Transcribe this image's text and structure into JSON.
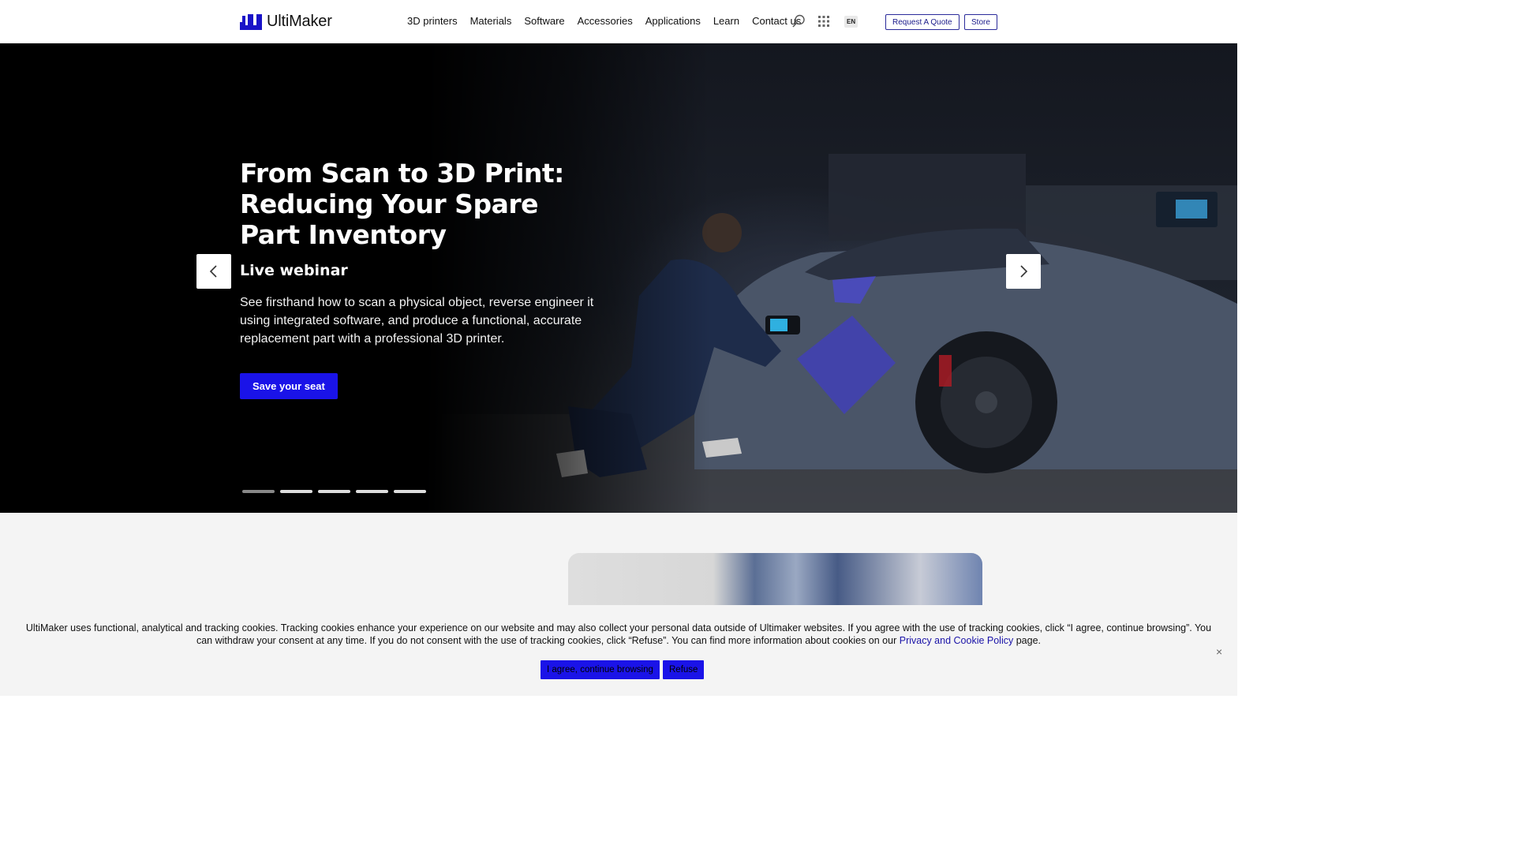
{
  "brand": {
    "name": "UltiMaker",
    "accent": "#1a13e8"
  },
  "nav": {
    "items": [
      "3D printers",
      "Materials",
      "Software",
      "Accessories",
      "Applications",
      "Learn",
      "Contact us"
    ]
  },
  "header": {
    "language": "EN",
    "quote_button": "Request A Quote",
    "store_button": "Store",
    "icons": [
      "search-icon",
      "apps-grid-icon"
    ]
  },
  "hero": {
    "title": "From Scan to 3D Print: Reducing Your Spare Part Inventory",
    "subtitle": "Live webinar",
    "description": "See firsthand how to scan a physical object, reverse engineer it using integrated software, and produce a functional, accurate replacement part with a professional 3D printer.",
    "cta": "Save your seat",
    "slides_total": 5,
    "active_slide": 1
  },
  "cookie": {
    "text_before": "UltiMaker uses functional, analytical and tracking cookies. Tracking cookies enhance your experience on our website and may also collect your personal data outside of Ultimaker websites. If you agree with the use of tracking cookies, click “I agree, continue browsing”. You can withdraw your consent at any time. If you do not consent with the use of tracking cookies, click “Refuse”. You can find more information about cookies on our ",
    "link": "Privacy and Cookie Policy",
    "text_after": " page.",
    "agree_button": "I agree, continue browsing",
    "refuse_button": "Refuse",
    "close": "×"
  }
}
